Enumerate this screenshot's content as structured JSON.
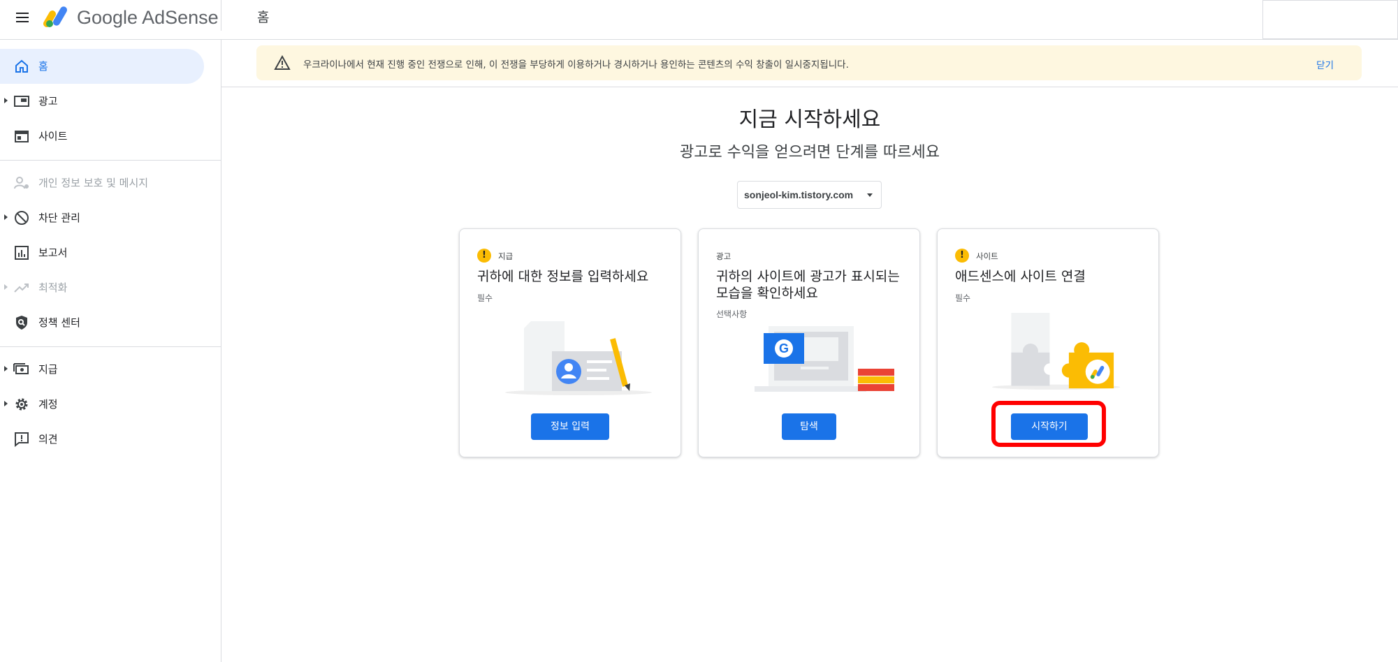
{
  "header": {
    "brand": "Google AdSense",
    "page_title": "홈"
  },
  "sidebar": {
    "items": [
      {
        "label": "홈",
        "icon": "home-icon"
      },
      {
        "label": "광고",
        "icon": "ads-icon"
      },
      {
        "label": "사이트",
        "icon": "sites-icon"
      },
      {
        "label": "개인 정보 보호 및 메시지",
        "icon": "privacy-icon"
      },
      {
        "label": "차단 관리",
        "icon": "block-icon"
      },
      {
        "label": "보고서",
        "icon": "reports-icon"
      },
      {
        "label": "최적화",
        "icon": "optimize-icon"
      },
      {
        "label": "정책 센터",
        "icon": "policy-icon"
      },
      {
        "label": "지급",
        "icon": "payments-icon"
      },
      {
        "label": "계정",
        "icon": "gear-icon"
      },
      {
        "label": "의견",
        "icon": "feedback-icon"
      }
    ]
  },
  "banner": {
    "message": "우크라이나에서 현재 진행 중인 전쟁으로 인해, 이 전쟁을 부당하게 이용하거나 경시하거나 용인하는 콘텐츠의 수익 창출이 일시중지됩니다.",
    "close_label": "닫기"
  },
  "main": {
    "title": "지금 시작하세요",
    "subtitle": "광고로 수익을 얻으려면 단계를 따르세요",
    "site_select": "sonjeol-kim.tistory.com",
    "cards": [
      {
        "tag": "지급",
        "title": "귀하에 대한 정보를 입력하세요",
        "requirement": "필수",
        "button": "정보 입력"
      },
      {
        "tag": "광고",
        "title": "귀하의 사이트에 광고가 표시되는 모습을 확인하세요",
        "requirement": "선택사항",
        "button": "탐색"
      },
      {
        "tag": "사이트",
        "title": "애드센스에 사이트 연결",
        "requirement": "필수",
        "button": "시작하기"
      }
    ]
  },
  "colors": {
    "accent": "#1a73e8",
    "active_nav_bg": "#e8f0fe",
    "banner_bg": "#fef7e0",
    "alert": "#fbbc04",
    "highlight": "#ff0000"
  }
}
